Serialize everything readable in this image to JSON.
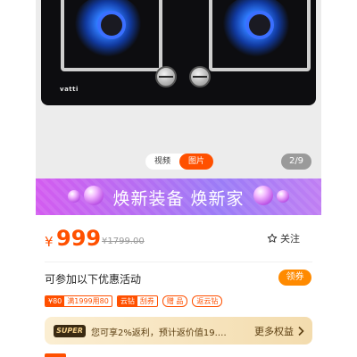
{
  "product_image": {
    "brand_text": "vatti"
  },
  "media_tabs": [
    {
      "label": "视频",
      "active": false
    },
    {
      "label": "图片",
      "active": true
    }
  ],
  "image_counter": "2/9",
  "banner": {
    "text": "焕新装备 焕新家"
  },
  "price": {
    "currency": "¥",
    "current": "999",
    "original": "¥1799.00"
  },
  "follow": {
    "label": "关注",
    "icon": "star-outline-icon"
  },
  "promotions": {
    "title": "可参加以下优惠活动",
    "coupon_button": "领券",
    "tags": [
      {
        "left": "¥80",
        "right": "满1999用80",
        "style": "split"
      },
      {
        "left": "云钻",
        "right": "刮券",
        "style": "split"
      },
      {
        "left": "",
        "right": "赠 品",
        "style": "round"
      },
      {
        "left": "",
        "right": "返云钻",
        "style": "round"
      }
    ]
  },
  "super_member": {
    "badge": "SUPER",
    "text": "您可享2%返利，预计返价值19.…",
    "more": "更多权益",
    "more_icon": "chevron-right-icon"
  },
  "colors": {
    "accent": "#ff5000",
    "coupon": "#ff8a00",
    "banner_start": "#d35cf0",
    "banner_end": "#9b7cf7",
    "super_bg": "#fbeed2"
  }
}
